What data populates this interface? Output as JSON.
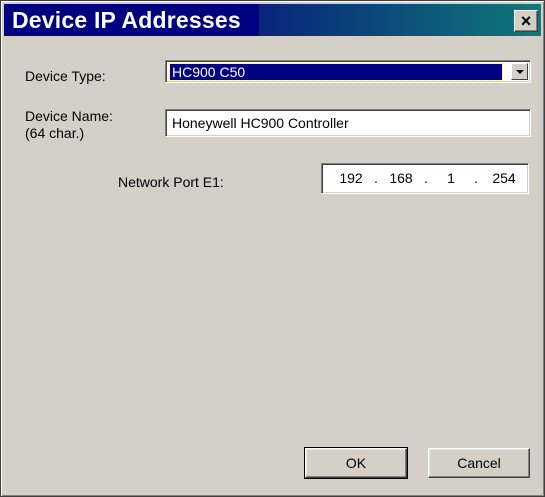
{
  "window": {
    "title": "Device IP Addresses",
    "close_symbol": "×",
    "close_icon": "close-icon"
  },
  "form": {
    "device_type_label": "Device Type:",
    "device_type_value": "HC900 C50",
    "device_name_label": "Device Name:",
    "device_name_hint": "(64 char.)",
    "device_name_value": "Honeywell HC900 Controller",
    "network_port_label": "Network Port E1:",
    "ip": [
      "192",
      "168",
      "1",
      "254"
    ],
    "ip_separator": "."
  },
  "buttons": {
    "ok": "OK",
    "cancel": "Cancel"
  },
  "colors": {
    "title_bar": "#000080",
    "selection": "#000080",
    "face": "#d4d0c8"
  }
}
